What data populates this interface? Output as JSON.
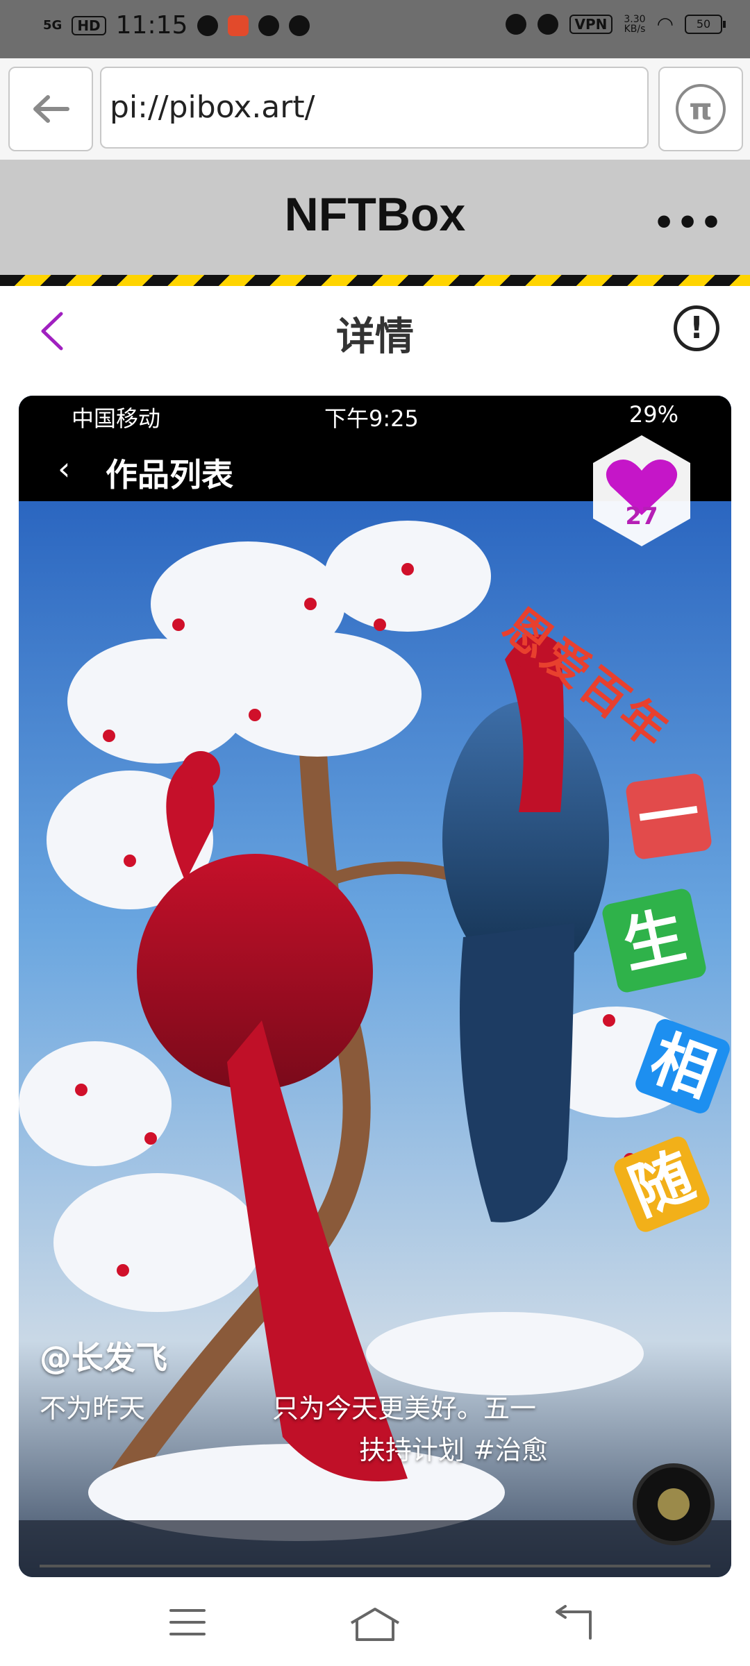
{
  "status_bar": {
    "network": "5G",
    "hd": "HD",
    "time": "11:15",
    "vpn": "VPN",
    "speed": "3.30\nKB/s",
    "battery": "50"
  },
  "browser": {
    "url": "pi://pibox.art/",
    "back_icon": "back-arrow-icon",
    "pi_icon": "pi-browser-icon"
  },
  "app_header": {
    "title": "NFTBox",
    "more": "•••"
  },
  "page_header": {
    "title": "详情",
    "info": "!"
  },
  "artwork": {
    "inner_status": {
      "carrier": "中国移动",
      "time": "下午9:25",
      "battery": "29%"
    },
    "inner_nav_title": "作品列表",
    "likes": "27",
    "overlay_text": "恩爱百年",
    "tiles": [
      {
        "char": "一",
        "color": "#e24b4b"
      },
      {
        "char": "生",
        "color": "#2fb24a"
      },
      {
        "char": "相",
        "color": "#1d8ff0"
      },
      {
        "char": "随",
        "color": "#f2b019"
      }
    ],
    "author": "@长发飞",
    "desc_line1": "不为昨天",
    "desc_line2": "只为今天更美好。五一",
    "desc_line3": "扶持计划 #治愈"
  },
  "colors": {
    "accent_purple": "#a020c0",
    "header_gray": "#c9c9c9",
    "hazard_yellow": "#ffd400"
  }
}
